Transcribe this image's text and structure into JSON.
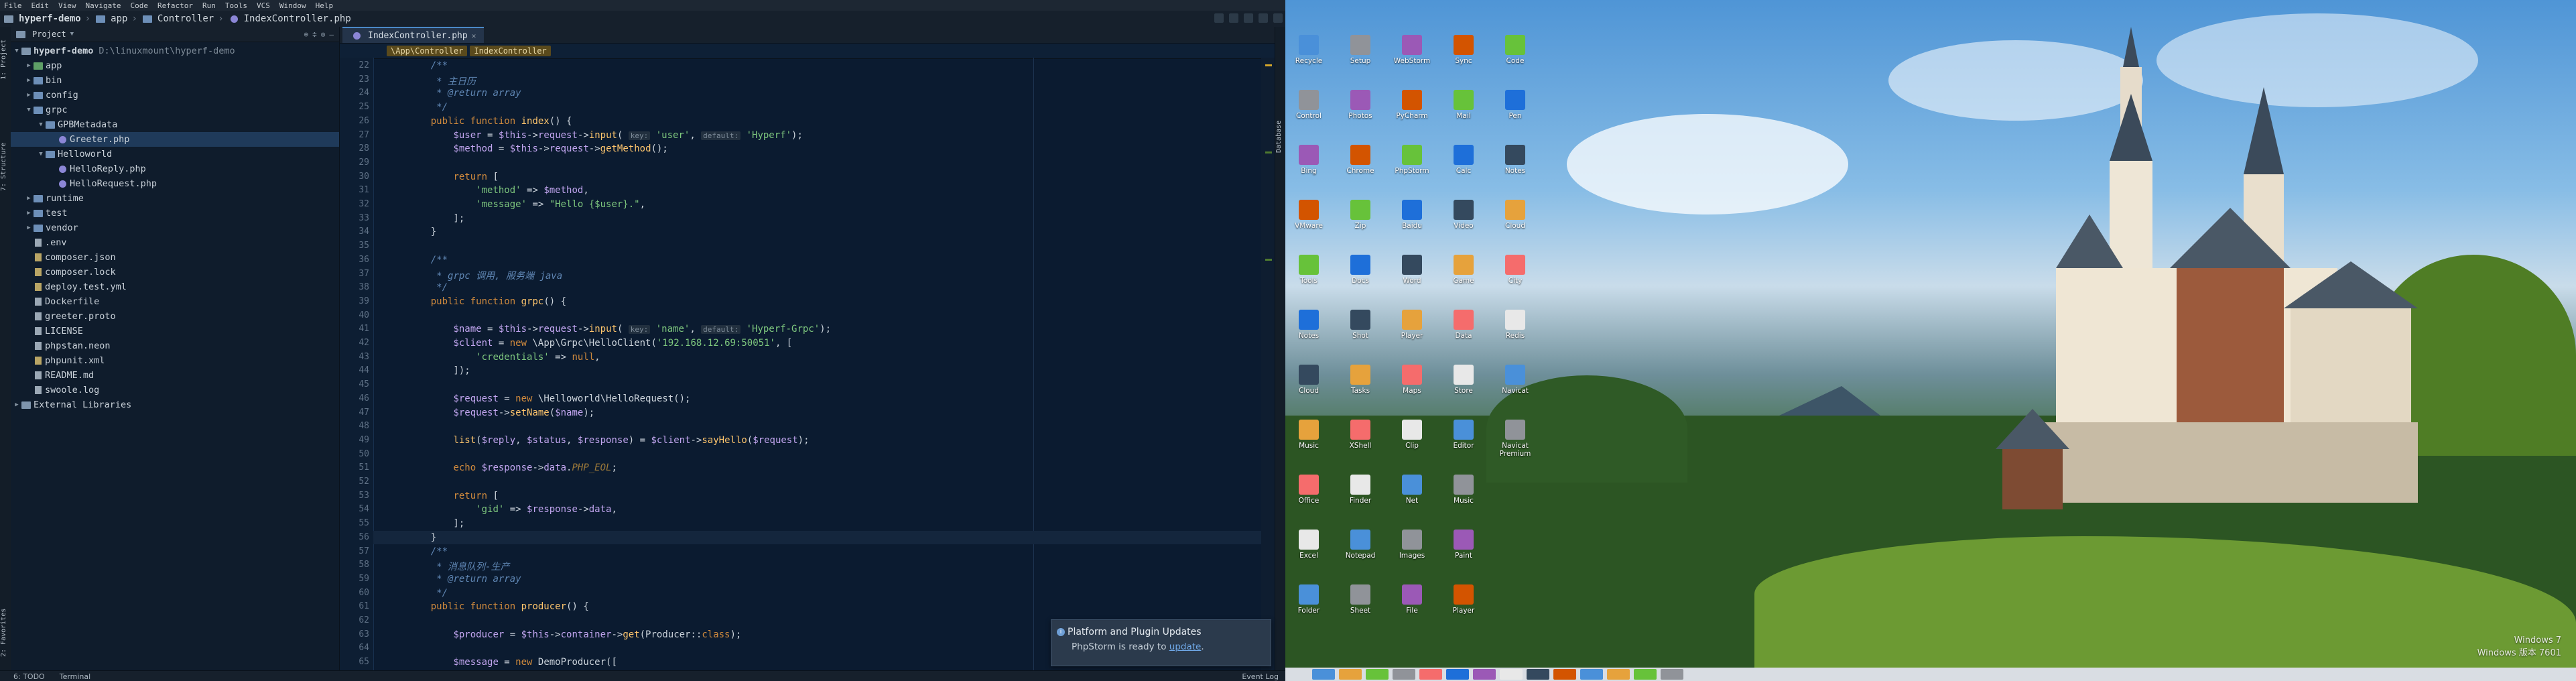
{
  "menu": [
    "File",
    "Edit",
    "View",
    "Navigate",
    "Code",
    "Refactor",
    "Run",
    "Tools",
    "VCS",
    "Window",
    "Help"
  ],
  "breadcrumbs": [
    "hyperf-demo",
    "app",
    "Controller",
    "IndexController.php"
  ],
  "project": {
    "title": "Project",
    "root": "hyperf-demo",
    "root_path": "D:\\linuxmount\\hyperf-demo",
    "items": [
      {
        "label": "app",
        "indent": 1,
        "type": "folder",
        "expanded": false
      },
      {
        "label": "bin",
        "indent": 1,
        "type": "folder",
        "expanded": false
      },
      {
        "label": "config",
        "indent": 1,
        "type": "folder",
        "expanded": false
      },
      {
        "label": "grpc",
        "indent": 1,
        "type": "folder",
        "expanded": true
      },
      {
        "label": "GPBMetadata",
        "indent": 2,
        "type": "folder",
        "expanded": true
      },
      {
        "label": "Greeter.php",
        "indent": 3,
        "type": "php",
        "selected": true
      },
      {
        "label": "Helloworld",
        "indent": 2,
        "type": "folder",
        "expanded": true
      },
      {
        "label": "HelloReply.php",
        "indent": 3,
        "type": "php"
      },
      {
        "label": "HelloRequest.php",
        "indent": 3,
        "type": "php"
      },
      {
        "label": "runtime",
        "indent": 1,
        "type": "folder",
        "expanded": false
      },
      {
        "label": "test",
        "indent": 1,
        "type": "folder",
        "expanded": false
      },
      {
        "label": "vendor",
        "indent": 1,
        "type": "folder",
        "expanded": false
      },
      {
        "label": ".env",
        "indent": 1,
        "type": "txt"
      },
      {
        "label": "composer.json",
        "indent": 1,
        "type": "cfg"
      },
      {
        "label": "composer.lock",
        "indent": 1,
        "type": "cfg"
      },
      {
        "label": "deploy.test.yml",
        "indent": 1,
        "type": "cfg"
      },
      {
        "label": "Dockerfile",
        "indent": 1,
        "type": "txt"
      },
      {
        "label": "greeter.proto",
        "indent": 1,
        "type": "txt"
      },
      {
        "label": "LICENSE",
        "indent": 1,
        "type": "txt"
      },
      {
        "label": "phpstan.neon",
        "indent": 1,
        "type": "txt"
      },
      {
        "label": "phpunit.xml",
        "indent": 1,
        "type": "cfg"
      },
      {
        "label": "README.md",
        "indent": 1,
        "type": "txt"
      },
      {
        "label": "swoole.log",
        "indent": 1,
        "type": "txt"
      },
      {
        "label": "External Libraries",
        "indent": 0,
        "type": "lib",
        "expanded": false
      }
    ]
  },
  "editor": {
    "tab": "IndexController.php",
    "path": [
      "\\App\\Controller",
      "IndexController"
    ],
    "current_line": 56,
    "lines": [
      {
        "n": 22,
        "html": "    <span class=\"cm\">/**</span>"
      },
      {
        "n": 23,
        "html": "     <span class=\"cm\">* 主日历</span>"
      },
      {
        "n": 24,
        "html": "     <span class=\"cm\">* @return array</span>"
      },
      {
        "n": 25,
        "html": "     <span class=\"cm\">*/</span>"
      },
      {
        "n": 26,
        "html": "    <span class=\"kw\">public function</span> <span class=\"fn\">index</span>() {"
      },
      {
        "n": 27,
        "html": "        <span class=\"var\">$user</span> = <span class=\"var\">$this</span>-&gt;<span class=\"var\">request</span>-&gt;<span class=\"fn\">input</span>( <span class=\"hint\">key:</span> <span class=\"str\">'user'</span>, <span class=\"hint\">default:</span> <span class=\"str\">'Hyperf'</span>);"
      },
      {
        "n": 28,
        "html": "        <span class=\"var\">$method</span> = <span class=\"var\">$this</span>-&gt;<span class=\"var\">request</span>-&gt;<span class=\"fn\">getMethod</span>();"
      },
      {
        "n": 29,
        "html": ""
      },
      {
        "n": 30,
        "html": "        <span class=\"kw\">return</span> ["
      },
      {
        "n": 31,
        "html": "            <span class=\"str\">'method'</span> =&gt; <span class=\"var\">$method</span>,"
      },
      {
        "n": 32,
        "html": "            <span class=\"str\">'message'</span> =&gt; <span class=\"str\">\"Hello {$user}.\"</span>,"
      },
      {
        "n": 33,
        "html": "        ];"
      },
      {
        "n": 34,
        "html": "    }"
      },
      {
        "n": 35,
        "html": ""
      },
      {
        "n": 36,
        "html": "    <span class=\"cm\">/**</span>"
      },
      {
        "n": 37,
        "html": "     <span class=\"cm\">* grpc 调用, 服务端 java</span>"
      },
      {
        "n": 38,
        "html": "     <span class=\"cm\">*/</span>"
      },
      {
        "n": 39,
        "html": "    <span class=\"kw\">public function</span> <span class=\"fn\">grpc</span>() {"
      },
      {
        "n": 40,
        "html": ""
      },
      {
        "n": 41,
        "html": "        <span class=\"var\">$name</span> = <span class=\"var\">$this</span>-&gt;<span class=\"var\">request</span>-&gt;<span class=\"fn\">input</span>( <span class=\"hint\">key:</span> <span class=\"str\">'name'</span>, <span class=\"hint\">default:</span> <span class=\"str\">'Hyperf-Grpc'</span>);"
      },
      {
        "n": 42,
        "html": "        <span class=\"var\">$client</span> = <span class=\"kw\">new</span> \\App\\Grpc\\HelloClient(<span class=\"str\">'192.168.12.69:50051'</span>, ["
      },
      {
        "n": 43,
        "html": "            <span class=\"str\">'credentials'</span> =&gt; <span class=\"kw\">null</span>,"
      },
      {
        "n": 44,
        "html": "        ]);"
      },
      {
        "n": 45,
        "html": ""
      },
      {
        "n": 46,
        "html": "        <span class=\"var\">$request</span> = <span class=\"kw\">new</span> \\Helloworld\\HelloRequest();"
      },
      {
        "n": 47,
        "html": "        <span class=\"var\">$request</span>-&gt;<span class=\"fn\">setName</span>(<span class=\"var\">$name</span>);"
      },
      {
        "n": 48,
        "html": ""
      },
      {
        "n": 49,
        "html": "        <span class=\"fn\">list</span>(<span class=\"var\">$reply</span>, <span class=\"var\">$status</span>, <span class=\"var\">$response</span>) = <span class=\"var\">$client</span>-&gt;<span class=\"fn\">sayHello</span>(<span class=\"var\">$request</span>);"
      },
      {
        "n": 50,
        "html": ""
      },
      {
        "n": 51,
        "html": "        <span class=\"kw\">echo</span> <span class=\"var\">$response</span>-&gt;<span class=\"var\">data</span>.<span class=\"ital\">PHP_EOL</span>;"
      },
      {
        "n": 52,
        "html": ""
      },
      {
        "n": 53,
        "html": "        <span class=\"kw\">return</span> ["
      },
      {
        "n": 54,
        "html": "            <span class=\"str\">'gid'</span> =&gt; <span class=\"var\">$response</span>-&gt;<span class=\"var\">data</span>,"
      },
      {
        "n": 55,
        "html": "        ];"
      },
      {
        "n": 56,
        "html": "    }"
      },
      {
        "n": 57,
        "html": "    <span class=\"cm\">/**</span>"
      },
      {
        "n": 58,
        "html": "     <span class=\"cm\">* 消息队列-生产</span>"
      },
      {
        "n": 59,
        "html": "     <span class=\"cm\">* @return array</span>"
      },
      {
        "n": 60,
        "html": "     <span class=\"cm\">*/</span>"
      },
      {
        "n": 61,
        "html": "    <span class=\"kw\">public function</span> <span class=\"fn\">producer</span>() {"
      },
      {
        "n": 62,
        "html": ""
      },
      {
        "n": 63,
        "html": "        <span class=\"var\">$producer</span> = <span class=\"var\">$this</span>-&gt;<span class=\"var\">container</span>-&gt;<span class=\"fn\">get</span>(Producer::<span class=\"kw\">class</span>);"
      },
      {
        "n": 64,
        "html": ""
      },
      {
        "n": 65,
        "html": "        <span class=\"var\">$message</span> = <span class=\"kw\">new</span> DemoProducer(["
      }
    ]
  },
  "notification": {
    "title": "Platform and Plugin Updates",
    "body": "PhpStorm is ready to",
    "link": "update",
    "suffix": "."
  },
  "tool_windows": {
    "left": [
      "1: Project",
      "7: Structure",
      "2: Favorites"
    ],
    "right": [
      "Database"
    ]
  },
  "status": {
    "items": [
      "6: TODO",
      "Terminal",
      "Event Log"
    ]
  },
  "desktop": {
    "icons": [
      "Recycle",
      "Control",
      "Bing",
      "VMware",
      "Tools",
      "Notes",
      "Cloud",
      "Music",
      "Office",
      "Excel",
      "Folder",
      "Setup",
      "Photos",
      "Chrome",
      "Zip",
      "Docs",
      "Shot",
      "Tasks",
      "XShell",
      "Finder",
      "Notepad",
      "Sheet",
      "WebStorm",
      "PyCharm",
      "PhpStorm",
      "Baidu",
      "Word",
      "Player",
      "Maps",
      "Clip",
      "Net",
      "Images",
      "File",
      "Sync",
      "Mail",
      "Calc",
      "Video",
      "Game",
      "Data",
      "Store",
      "Editor",
      "Music",
      "Paint",
      "Player",
      "Code",
      "Pen",
      "Notes",
      "Cloud",
      "City",
      "Redis",
      "Navicat",
      "Navicat Premium"
    ],
    "os_line1": "Windows 7",
    "os_line2": "Windows 版本 7601"
  }
}
